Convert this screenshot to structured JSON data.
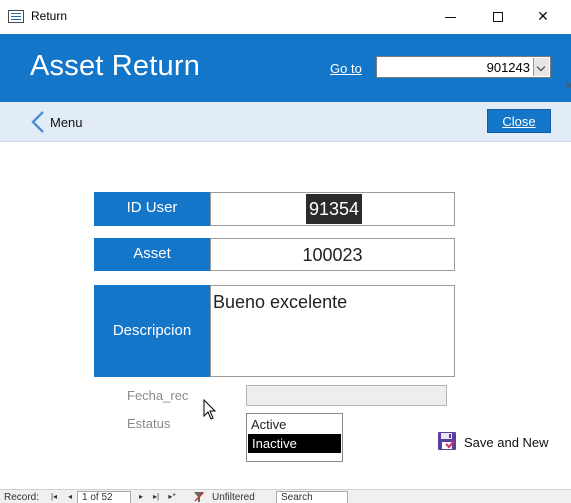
{
  "window": {
    "title": "Return",
    "minimize_label": "",
    "maximize_label": "",
    "close_glyph": "✕"
  },
  "header": {
    "title": "Asset Return",
    "goto_label": "Go to",
    "goto_value": "901243"
  },
  "navbar": {
    "menu_label": "Menu",
    "close_label": "Close"
  },
  "form": {
    "id_user_label": "ID User",
    "id_user_value": "91354",
    "asset_label": "Asset",
    "asset_value": "100023",
    "descripcion_label": "Descripcion",
    "descripcion_value": "Bueno excelente",
    "fecha_label": "Fecha_rec",
    "fecha_value": "",
    "estatus_label": "Estatus",
    "estatus_options": [
      "Active",
      "Inactive"
    ],
    "estatus_selected": "Inactive",
    "save_new_label": "Save and New"
  },
  "record_nav": {
    "label": "Record:",
    "position": "1 of 52",
    "filter_label": "Unfiltered",
    "search_placeholder": "Search"
  },
  "colors": {
    "accent": "#1476c8",
    "navbar_bg": "#e2ecf7",
    "selected_bg": "#000000"
  },
  "icons": {
    "app": "form-icon",
    "back": "chevron-left-icon",
    "save": "disk-icon",
    "filter": "funnel-icon"
  }
}
